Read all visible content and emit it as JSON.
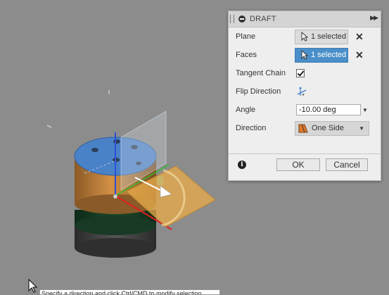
{
  "panel": {
    "title": "DRAFT",
    "plane": {
      "label": "Plane",
      "value": "1 selected"
    },
    "faces": {
      "label": "Faces",
      "value": "1 selected"
    },
    "tangent_chain": {
      "label": "Tangent Chain",
      "checked": true
    },
    "flip_direction": {
      "label": "Flip Direction"
    },
    "angle": {
      "label": "Angle",
      "value": "-10.00 deg"
    },
    "direction": {
      "label": "Direction",
      "value": "One Side"
    },
    "ok_label": "OK",
    "cancel_label": "Cancel"
  },
  "tooltip": {
    "text": "Specify a direction and click Ctrl/CMD to modify selection"
  },
  "colors": {
    "viewport_bg": "#8c8c8c",
    "selected_blue": "#4a8fc9",
    "plane_orange": "#e6a94a",
    "axis_blue": "#2d4fd6",
    "axis_green": "#2ec02e",
    "axis_red": "#e02020"
  },
  "icons": [
    "collapse-icon",
    "expand-arrows-icon",
    "cursor-arrow-icon",
    "close-icon",
    "flip-direction-icon",
    "dropdown-icon",
    "info-icon",
    "mouse-pointer-icon",
    "direction-one-side-icon"
  ]
}
